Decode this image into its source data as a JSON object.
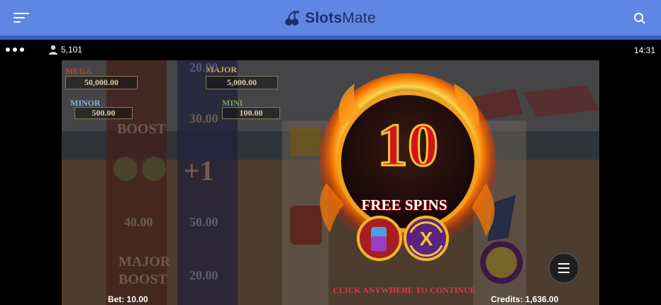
{
  "header": {
    "logo": {
      "slots": "Slots",
      "mate": "Mate"
    },
    "menu_icon": "hamburger-icon",
    "search_icon": "search-icon",
    "bg_color": "#5f86e2"
  },
  "status": {
    "players_icon": "user-icon",
    "players_count": "5,101",
    "time": "14:31"
  },
  "game": {
    "jackpots": {
      "mega_label": "MEGA",
      "mega_value": "50,000.00",
      "major_label": "MAJOR",
      "major_value": "5,000.00",
      "minor_label": "MINOR",
      "minor_value": "500.00",
      "mini_label": "MINI",
      "mini_value": "100.00"
    },
    "reel_values": [
      "30.00",
      "40.00",
      "50.00",
      "20.00",
      "+1"
    ],
    "boost_labels": [
      "BOOST",
      "MAJOR",
      "BOOST"
    ],
    "free_spins": {
      "count": "10",
      "label": "FREE SPINS",
      "continue_text": "CLICK ANYWHERE TO CONTINUE"
    },
    "bet_label": "Bet: 10.00",
    "credits_label": "Credits: 1,636.00"
  }
}
